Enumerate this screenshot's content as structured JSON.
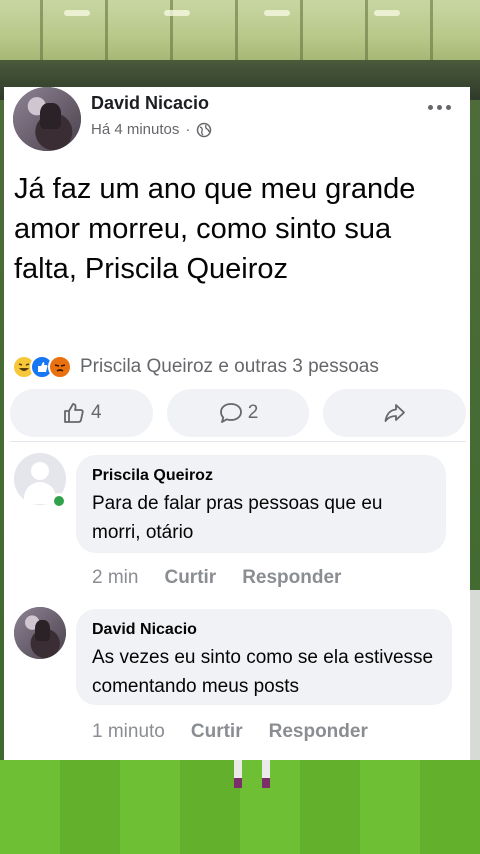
{
  "post": {
    "author": "David Nicacio",
    "time": "Há 4 minutos",
    "separator": "·",
    "privacy_icon": "globe-icon",
    "text": "Já faz um ano que meu grande amor morreu, como sinto sua falta, Priscila Queiroz",
    "reactions_summary": "Priscila Queiroz e outras 3 pessoas",
    "reaction_icons": [
      "haha-reaction-icon",
      "like-reaction-icon",
      "angry-reaction-icon"
    ],
    "like_count": "4",
    "comment_count": "2"
  },
  "comments": [
    {
      "author": "Priscila Queiroz",
      "text": "Para de falar pras pessoas que eu morri, otário",
      "time": "2 min",
      "like_label": "Curtir",
      "reply_label": "Responder"
    },
    {
      "author": "David Nicacio",
      "text": "As vezes eu sinto como se ela estivesse comentando meus posts",
      "time": "1 minuto",
      "like_label": "Curtir",
      "reply_label": "Responder"
    }
  ],
  "colors": {
    "secondary_text": "#65676b",
    "bubble_bg": "#f0f2f5",
    "online_green": "#31a24c",
    "like_blue": "#1877f2"
  }
}
